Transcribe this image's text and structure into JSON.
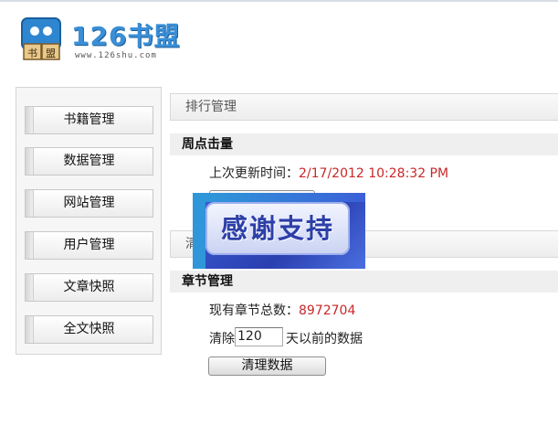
{
  "logo": {
    "brand": "126书盟",
    "url": "www.126shu.com",
    "tile_left": "书",
    "tile_right": "盟"
  },
  "sidebar": {
    "items": [
      {
        "label": "书籍管理"
      },
      {
        "label": "数据管理"
      },
      {
        "label": "网站管理"
      },
      {
        "label": "用户管理"
      },
      {
        "label": "文章快照"
      },
      {
        "label": "全文快照"
      }
    ]
  },
  "main": {
    "ranking_header": "排行管理",
    "weekly_clicks": {
      "title": "周点击量",
      "last_update_label": "上次更新时间：",
      "last_update_value": "2/17/2012 10:28:32 PM"
    },
    "second_header_partial": "清",
    "chapters": {
      "title": "章节管理",
      "total_label": "现有章节总数：",
      "total_value": "8972704",
      "clear_prefix": "清除",
      "days_value": "120",
      "clear_suffix": "天以前的数据",
      "clear_button": "清理数据"
    }
  },
  "overlay": {
    "text": "感谢支持"
  },
  "colors": {
    "accent_red": "#c8282a",
    "logo_blue": "#3a8fd6",
    "overlay_blue": "#2b3fb0"
  }
}
